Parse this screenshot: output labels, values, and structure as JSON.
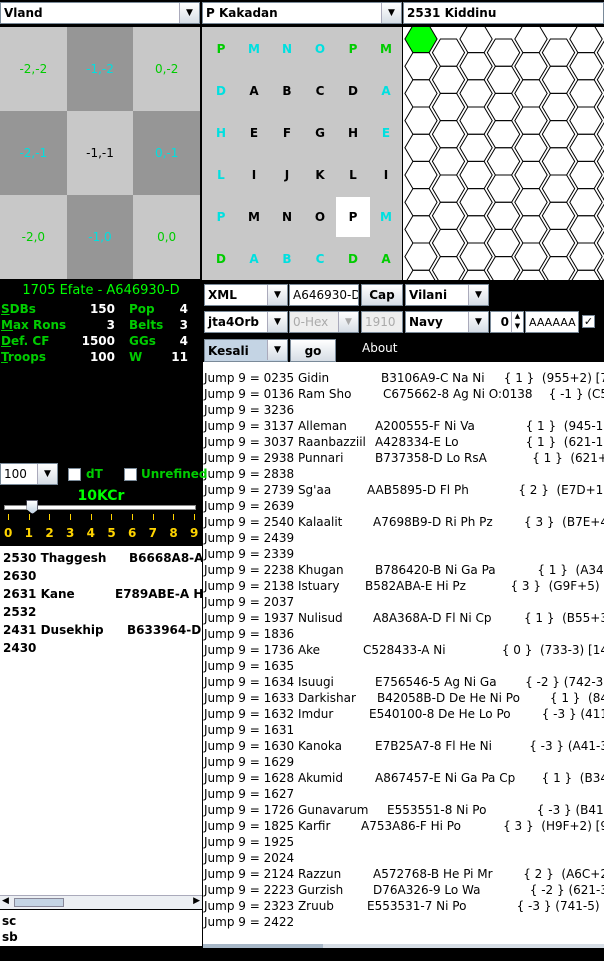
{
  "top_selectors": {
    "left": "Vland",
    "middle": "P Kakadan",
    "right": "2531 Kiddinu",
    "arrow": "▼"
  },
  "sector_grid": {
    "cells": [
      {
        "label": "-2,-2",
        "bg": "#c8c8c8",
        "color": "#00cc00"
      },
      {
        "label": "-1,-2",
        "bg": "#969696",
        "color": "#00e0e0"
      },
      {
        "label": "0,-2",
        "bg": "#c8c8c8",
        "color": "#00cc00"
      },
      {
        "label": "-2,-1",
        "bg": "#969696",
        "color": "#00e0e0"
      },
      {
        "label": "-1,-1",
        "bg": "#c8c8c8",
        "color": "#000000"
      },
      {
        "label": "0,-1",
        "bg": "#969696",
        "color": "#00e0e0"
      },
      {
        "label": "-2,0",
        "bg": "#c8c8c8",
        "color": "#00cc00"
      },
      {
        "label": "-1,0",
        "bg": "#969696",
        "color": "#00e0e0"
      },
      {
        "label": "0,0",
        "bg": "#c8c8c8",
        "color": "#00cc00"
      }
    ]
  },
  "subsector_grid": {
    "rows": [
      [
        "P",
        "M",
        "N",
        "O",
        "P",
        "M"
      ],
      [
        "D",
        "A",
        "B",
        "C",
        "D",
        "A"
      ],
      [
        "H",
        "E",
        "F",
        "G",
        "H",
        "E"
      ],
      [
        "L",
        "I",
        "J",
        "K",
        "L",
        "I"
      ],
      [
        "P",
        "M",
        "N",
        "O",
        "P",
        "M"
      ],
      [
        "D",
        "A",
        "B",
        "C",
        "D",
        "A"
      ]
    ],
    "colors": [
      [
        "#00cc00",
        "#00e0e0",
        "#00e0e0",
        "#00e0e0",
        "#00cc00",
        "#00cc00"
      ],
      [
        "#00e0e0",
        "#000",
        "#000",
        "#000",
        "#000",
        "#00e0e0"
      ],
      [
        "#00e0e0",
        "#000",
        "#000",
        "#000",
        "#000",
        "#00e0e0"
      ],
      [
        "#00e0e0",
        "#000",
        "#000",
        "#000",
        "#000",
        "#000"
      ],
      [
        "#00e0e0",
        "#000",
        "#000",
        "#000",
        "#000",
        "#00e0e0"
      ],
      [
        "#00cc00",
        "#00e0e0",
        "#00e0e0",
        "#00e0e0",
        "#00cc00",
        "#00cc00"
      ]
    ],
    "selected": [
      4,
      4
    ]
  },
  "world": {
    "title": "1705 Efate - A646930-D",
    "stats": [
      {
        "label": "SDBs",
        "ul": "S",
        "rest": "DBs",
        "value": "150",
        "label2": "Pop",
        "value2": "4"
      },
      {
        "label": "Max Rons",
        "ul": "M",
        "rest": "ax Rons",
        "value": "3",
        "label2": "Belts",
        "value2": "3"
      },
      {
        "label": "Def. CF",
        "ul": "D",
        "rest": "ef. CF",
        "value": "1500",
        "label2": "GGs",
        "value2": "4"
      },
      {
        "label": "Troops",
        "ul": "T",
        "rest": "roops",
        "value": "100",
        "label2": "W",
        "value2": "11"
      }
    ]
  },
  "controls": {
    "format": "XML",
    "uwp_field": "A646930-D",
    "cap_button": "Cap",
    "allegiance": "Vilani",
    "plugin": "jta4Orb",
    "hex_select": "0-Hex",
    "year_field": "1910",
    "base": "Navy",
    "spinner_value": "0",
    "code_field": "AAAAAA",
    "search_combo": "Kesali",
    "go_button": "go",
    "about_label": "About"
  },
  "range_panel": {
    "range_value": "100",
    "dt_label": "dT",
    "unrefined_label": "Unrefined",
    "cost_label": "10KCr",
    "slider_ticks": [
      "0",
      "1",
      "2",
      "3",
      "4",
      "5",
      "6",
      "7",
      "8",
      "9"
    ],
    "slider_value": 1
  },
  "nearby_list": [
    {
      "hex": "2530 Thaggesh",
      "uwp": "B6668A8-A G"
    },
    {
      "hex": "2630",
      "uwp": ""
    },
    {
      "hex": "2631 Kane",
      "uwp": "E789ABE-A Hi P"
    },
    {
      "hex": "2532",
      "uwp": ""
    },
    {
      "hex": "2431 Dusekhip",
      "uwp": "B633964-D H"
    },
    {
      "hex": "2430",
      "uwp": ""
    }
  ],
  "bottom_labels": [
    "sc",
    "sb"
  ],
  "jump_list": [
    {
      "name": "Jump 9 = 0235 Gidin",
      "uwp": "B3106A9-C Na Ni",
      "extra": "{ 1 }  (955+2) [7"
    },
    {
      "name": "Jump 9 = 0136 Ram Sho",
      "uwp": "C675662-8 Ag Ni O:0138",
      "extra": "{ -1 } (C5"
    },
    {
      "name": "Jump 9 = 3236",
      "uwp": "",
      "extra": ""
    },
    {
      "name": "Jump 9 = 3137 Alleman",
      "uwp": "A200555-F Ni Va",
      "extra": "{ 1 }  (945-1)"
    },
    {
      "name": "Jump 9 = 3037 Raanbazziil",
      "uwp": "A428334-E Lo",
      "extra": "{ 1 }  (621-1)"
    },
    {
      "name": "Jump 9 = 2938 Punnari",
      "uwp": "B737358-D Lo RsA",
      "extra": "{ 1 }  (621+"
    },
    {
      "name": "Jump 9 = 2838",
      "uwp": "",
      "extra": ""
    },
    {
      "name": "Jump 9 = 2739 Sg'aa",
      "uwp": "AAB5895-D Fl Ph",
      "extra": "{ 2 }  (E7D+1)"
    },
    {
      "name": "Jump 9 = 2639",
      "uwp": "",
      "extra": ""
    },
    {
      "name": "Jump 9 = 2540 Kalaalit",
      "uwp": "A7698B9-D Ri Ph Pz",
      "extra": "{ 3 }  (B7E+4"
    },
    {
      "name": "Jump 9 = 2439",
      "uwp": "",
      "extra": ""
    },
    {
      "name": "Jump 9 = 2339",
      "uwp": "",
      "extra": ""
    },
    {
      "name": "Jump 9 = 2238 Khugan",
      "uwp": "B786420-B Ni Ga Pa",
      "extra": "{ 1 }  (A34-"
    },
    {
      "name": "Jump 9 = 2138 Istuary",
      "uwp": "B582ABA-E Hi Pz",
      "extra": "{ 3 }  (G9F+5) ["
    },
    {
      "name": "Jump 9 = 2037",
      "uwp": "",
      "extra": ""
    },
    {
      "name": "Jump 9 = 1937 Nulisud",
      "uwp": "A8A368A-D Fl Ni Cp",
      "extra": "{ 1 }  (B55+3"
    },
    {
      "name": "Jump 9 = 1836",
      "uwp": "",
      "extra": ""
    },
    {
      "name": "Jump 9 = 1736 Ake",
      "uwp": "C528433-A Ni",
      "extra": "{ 0 }  (733-3) [14"
    },
    {
      "name": "Jump 9 = 1635",
      "uwp": "",
      "extra": ""
    },
    {
      "name": "Jump 9 = 1634 Isuugi",
      "uwp": "E756546-5 Ag Ni Ga",
      "extra": "{ -2 } (742-3)"
    },
    {
      "name": "Jump 9 = 1633 Darkishar",
      "uwp": "B42058B-D De He Ni Po",
      "extra": "{ 1 }  (84"
    },
    {
      "name": "Jump 9 = 1632 Imdur",
      "uwp": "E540100-8 De He Lo Po",
      "extra": "{ -3 } (411"
    },
    {
      "name": "Jump 9 = 1631",
      "uwp": "",
      "extra": ""
    },
    {
      "name": "Jump 9 = 1630 Kanoka",
      "uwp": "E7B25A7-8 Fl He Ni",
      "extra": "{ -3 } (A41-3"
    },
    {
      "name": "Jump 9 = 1629",
      "uwp": "",
      "extra": ""
    },
    {
      "name": "Jump 9 = 1628 Akumid",
      "uwp": "A867457-E Ni Ga Pa Cp",
      "extra": "{ 1 }  (B34"
    },
    {
      "name": "Jump 9 = 1627",
      "uwp": "",
      "extra": ""
    },
    {
      "name": "Jump 9 = 1726 Gunavarum",
      "uwp": "E553551-8 Ni Po",
      "extra": "{ -3 } (B41-"
    },
    {
      "name": "Jump 9 = 1825 Karfir",
      "uwp": "A753A86-F Hi Po",
      "extra": "{ 3 }  (H9F+2) [9"
    },
    {
      "name": "Jump 9 = 1925",
      "uwp": "",
      "extra": ""
    },
    {
      "name": "Jump 9 = 2024",
      "uwp": "",
      "extra": ""
    },
    {
      "name": "Jump 9 = 2124 Razzun",
      "uwp": "A572768-B He Pi Mr",
      "extra": "{ 2 }  (A6C+2"
    },
    {
      "name": "Jump 9 = 2223 Gurzish",
      "uwp": "D76A326-9 Lo Wa",
      "extra": "{ -2 } (621-3"
    },
    {
      "name": "Jump 9 = 2323 Zruub",
      "uwp": "E553531-7 Ni Po",
      "extra": "{ -3 } (741-5) ["
    },
    {
      "name": "Jump 9 = 2422",
      "uwp": "",
      "extra": ""
    }
  ],
  "colors": {
    "accent_green": "#00cc00",
    "cyan": "#00e0e0",
    "tick_yellow": "#ffd400",
    "title_green": "#00ff00"
  }
}
